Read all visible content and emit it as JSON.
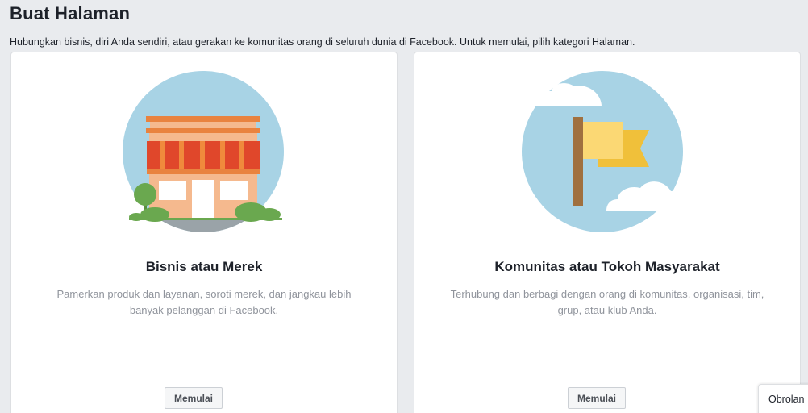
{
  "page": {
    "title": "Buat Halaman",
    "subtitle": "Hubungkan bisnis, diri Anda sendiri, atau gerakan ke komunitas orang di seluruh dunia di Facebook. Untuk memulai, pilih kategori Halaman."
  },
  "cards": [
    {
      "illustration": "storefront-illustration",
      "title": "Bisnis atau Merek",
      "description": "Pamerkan produk dan layanan, soroti merek, dan jangkau lebih banyak pelanggan di Facebook.",
      "button_label": "Memulai"
    },
    {
      "illustration": "flag-illustration",
      "title": "Komunitas atau Tokoh Masyarakat",
      "description": "Terhubung dan berbagi dengan orang di komunitas, organisasi, tim, grup, atau klub Anda.",
      "button_label": "Memulai"
    }
  ],
  "chat": {
    "label": "Obrolan"
  },
  "colors": {
    "background": "#e9ebee",
    "card": "#ffffff",
    "sky_circle": "#a8d3e5",
    "awning_red": "#e0472b",
    "roof_orange": "#e9833f",
    "wall_peach": "#f5b98e",
    "tree_green": "#6aa84f",
    "flag_yellow": "#fbd874",
    "flag_dark_yellow": "#f0c03a",
    "pole_brown": "#a0703f",
    "muted_text": "#90949c"
  }
}
